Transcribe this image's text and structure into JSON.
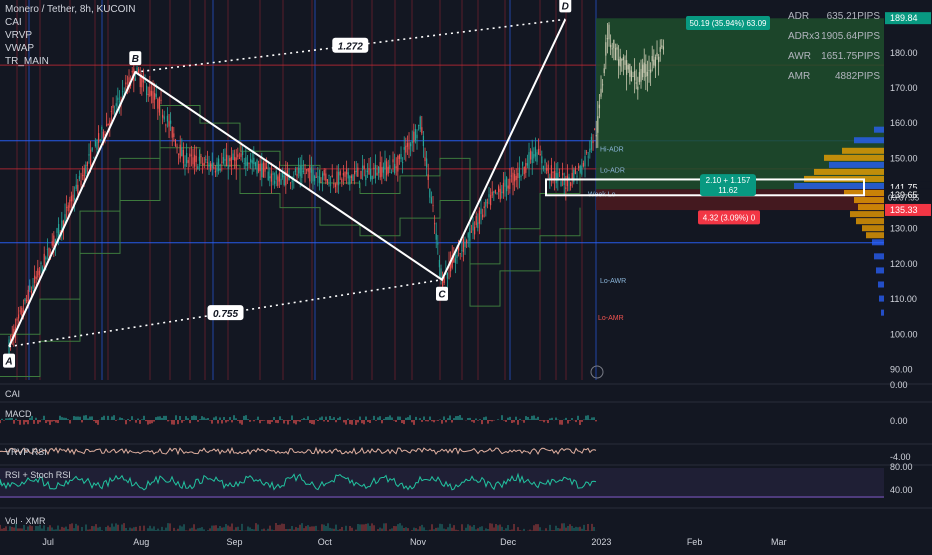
{
  "header": {
    "title": "Monero / Tether, 8h, KUCOIN",
    "indicators": [
      "CAI",
      "VRVP",
      "VWAP",
      "TR_MAIN"
    ]
  },
  "adr_table": [
    {
      "label": "ADR",
      "value": "635.21PIPS"
    },
    {
      "label": "ADRx3",
      "value": "1905.64PIPS"
    },
    {
      "label": "AWR",
      "value": "1651.75PIPS"
    },
    {
      "label": "AMR",
      "value": "4882PIPS"
    }
  ],
  "pattern": {
    "points": [
      {
        "label": "A",
        "date": "2022-06-18",
        "price": 96.5
      },
      {
        "label": "B",
        "date": "2022-07-30",
        "price": 174.5
      },
      {
        "label": "C",
        "date": "2022-11-09",
        "price": 115.5
      },
      {
        "label": "D",
        "date": "2022-12-20",
        "price": 189.5
      }
    ],
    "ratios": [
      {
        "label": "1.272",
        "from": "B",
        "to": "D"
      },
      {
        "label": "0.755",
        "from": "A",
        "to": "C"
      }
    ]
  },
  "annotations": {
    "top_badge": "50.19 (35.94%) 63.09",
    "measure_box_line1": "2.10 + 1.157",
    "measure_box_line2": "11.62",
    "loss_badge": "4.32 (3.09%) 0",
    "level_labels": [
      "Lo-AWR",
      "Hi-ADR",
      "Lo-ADR",
      "Week Lo",
      "Lo-AMR"
    ],
    "countdown": "03:07:35"
  },
  "price_axis": {
    "ticks": [
      "180.00",
      "170.00",
      "160.00",
      "150.00",
      "130.00",
      "120.00",
      "110.00",
      "100.00",
      "90.00"
    ],
    "tags": [
      {
        "value": "189.84",
        "color": "#089981"
      },
      {
        "value": "141.75",
        "color": "#131722"
      },
      {
        "value": "139.65",
        "color": "#131722"
      },
      {
        "value": "135.33",
        "color": "#f23645"
      }
    ]
  },
  "time_axis": {
    "labels": [
      "Jul",
      "Aug",
      "Sep",
      "Oct",
      "Nov",
      "Dec",
      "2023",
      "Feb",
      "Mar"
    ]
  },
  "panes": [
    {
      "name": "CAI",
      "ticks": [
        "0.00"
      ]
    },
    {
      "name": "MACD",
      "ticks": [
        "0.00"
      ]
    },
    {
      "name": "VRVP RSI",
      "ticks": [
        "-4.00"
      ]
    },
    {
      "name": "RSI + Stoch RSI",
      "ticks": [
        "80.00",
        "40.00"
      ]
    },
    {
      "name": "Vol · XMR",
      "ticks": []
    }
  ],
  "colors": {
    "background": "#131722",
    "bull": "#26a69a",
    "bear": "#ef5350",
    "pattern_line": "#ffffff",
    "profit_zone": "#1e4d2b",
    "loss_zone": "#4a1a1f",
    "blue_line": "#2962ff",
    "red_line": "#b22833",
    "rsi": "#22c3a0",
    "volume_profile_up": "#2962ff",
    "volume_profile_down": "#f7a600"
  },
  "chart_data": {
    "type": "candlestick",
    "x_axis": {
      "type": "date",
      "range": [
        "2022-06-15",
        "2023-04-05"
      ],
      "labels": [
        "Jul",
        "Aug",
        "Sep",
        "Oct",
        "Nov",
        "Dec",
        "2023",
        "Feb",
        "Mar"
      ]
    },
    "y_axis": {
      "range": [
        87,
        195
      ]
    },
    "price_series": [
      {
        "date": "2022-06-18",
        "price": 96.5
      },
      {
        "date": "2022-06-25",
        "price": 112
      },
      {
        "date": "2022-07-05",
        "price": 130
      },
      {
        "date": "2022-07-15",
        "price": 150
      },
      {
        "date": "2022-07-22",
        "price": 162
      },
      {
        "date": "2022-07-30",
        "price": 174.5
      },
      {
        "date": "2022-08-08",
        "price": 164
      },
      {
        "date": "2022-08-15",
        "price": 150
      },
      {
        "date": "2022-08-25",
        "price": 148
      },
      {
        "date": "2022-09-05",
        "price": 150
      },
      {
        "date": "2022-09-15",
        "price": 144
      },
      {
        "date": "2022-09-25",
        "price": 146
      },
      {
        "date": "2022-10-05",
        "price": 144
      },
      {
        "date": "2022-10-15",
        "price": 146
      },
      {
        "date": "2022-10-25",
        "price": 148
      },
      {
        "date": "2022-11-02",
        "price": 160
      },
      {
        "date": "2022-11-09",
        "price": 115.5
      },
      {
        "date": "2022-11-16",
        "price": 125
      },
      {
        "date": "2022-11-25",
        "price": 138
      },
      {
        "date": "2022-12-05",
        "price": 146
      },
      {
        "date": "2022-12-10",
        "price": 152
      },
      {
        "date": "2022-12-15",
        "price": 146
      },
      {
        "date": "2022-12-20",
        "price": 143
      },
      {
        "date": "2022-12-26",
        "price": 148
      },
      {
        "date": "2022-12-31",
        "price": 160
      },
      {
        "date": "2023-01-03",
        "price": 186
      },
      {
        "date": "2023-01-08",
        "price": 176
      },
      {
        "date": "2023-01-13",
        "price": 172
      },
      {
        "date": "2023-01-18",
        "price": 177
      },
      {
        "date": "2023-01-22",
        "price": 180
      }
    ],
    "horizontal_levels": [
      {
        "price": 155,
        "color": "#2962ff"
      },
      {
        "price": 147,
        "color": "#b22833"
      },
      {
        "price": 126,
        "color": "#2962ff"
      },
      {
        "price": 176.5,
        "color": "#b22833"
      }
    ]
  }
}
